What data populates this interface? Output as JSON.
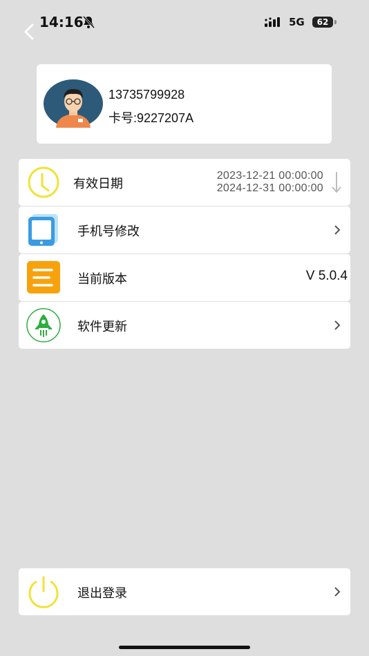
{
  "status_bar": {
    "time": "14:16",
    "network": "5G",
    "battery": "62"
  },
  "profile": {
    "phone": "13735799928",
    "card_number": "卡号:9227207A"
  },
  "menu": {
    "validity": {
      "label": "有效日期",
      "start": "2023-12-21 00:00:00",
      "end": "2024-12-31 00:00:00"
    },
    "change_phone": {
      "label": "手机号修改"
    },
    "version": {
      "label": "当前版本",
      "value": "V 5.0.4"
    },
    "update": {
      "label": "软件更新"
    }
  },
  "logout": {
    "label": "退出登录"
  },
  "colors": {
    "background": "#dedede",
    "card": "#ffffff",
    "clock_yellow": "#f2e236",
    "phone_blue": "#3a9be3",
    "version_orange": "#f7a20d",
    "rocket_green": "#2cae3c"
  }
}
